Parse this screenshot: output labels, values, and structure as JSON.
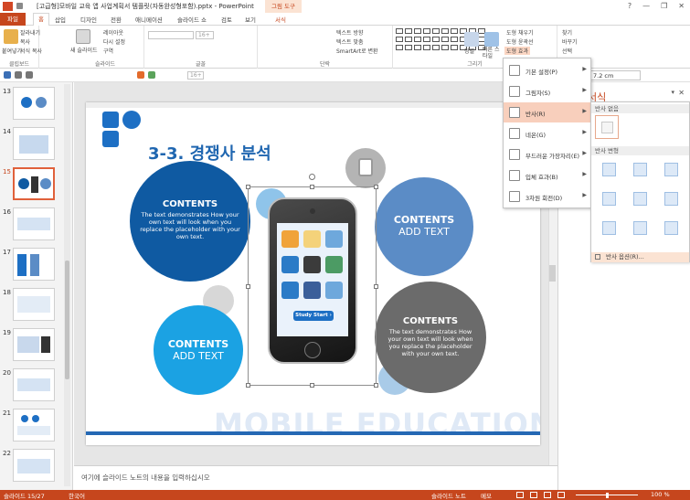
{
  "window": {
    "title": "[고급형]모바일 교육 앱 사업계획서 템플릿(자동완성형포함).pptx - PowerPoint",
    "context_tool": "그림 도구",
    "controls": [
      "?",
      "—",
      "❐",
      "✕"
    ]
  },
  "tabs": [
    "파일",
    "홈",
    "삽입",
    "디자인",
    "전환",
    "애니메이션",
    "슬라이드 쇼",
    "검토",
    "보기",
    "서식"
  ],
  "ribbon": {
    "clipboard": {
      "paste": "붙여넣기",
      "cut": "잘라내기",
      "copy": "복사",
      "format_painter": "서식 복사",
      "label": "클립보드"
    },
    "slides": {
      "new_slide": "새 슬라이드",
      "layout": "레이아웃",
      "reset": "다시 설정",
      "section": "구역",
      "label": "슬라이드"
    },
    "font": {
      "size": "16+",
      "label": "글꼴"
    },
    "paragraph": {
      "text_direction": "텍스트 방향",
      "align_text": "텍스트 맞춤",
      "smartart": "SmartArt로 변환",
      "label": "단락"
    },
    "drawing": {
      "arrange": "정렬",
      "quick_styles": "빠른 스타일",
      "fill": "도형 채우기",
      "outline": "도형 윤곽선",
      "effects": "도형 효과",
      "label": "그리기"
    },
    "editing": {
      "find": "찾기",
      "replace": "바꾸기",
      "select": "선택"
    }
  },
  "toolbar2": {
    "font_size": "16+"
  },
  "slides_panel": {
    "items": [
      {
        "num": "13",
        "selected": false
      },
      {
        "num": "14",
        "selected": false
      },
      {
        "num": "15",
        "selected": true
      },
      {
        "num": "16",
        "selected": false
      },
      {
        "num": "17",
        "selected": false
      },
      {
        "num": "18",
        "selected": false
      },
      {
        "num": "19",
        "selected": false
      },
      {
        "num": "20",
        "selected": false
      },
      {
        "num": "21",
        "selected": false
      },
      {
        "num": "22",
        "selected": false
      }
    ]
  },
  "slide": {
    "title": "3-3. 경쟁사 분석",
    "watermark": "MOBILE EDUCATION",
    "bubble1": {
      "head": "CONTENTS",
      "body": "The text demonstrates How your own text will look when you replace the placeholder with your own text."
    },
    "bubble2": {
      "head": "CONTENTS",
      "sub": "ADD TEXT"
    },
    "bubble3": {
      "head": "CONTENTS",
      "sub": "ADD TEXT"
    },
    "bubble4": {
      "head": "CONTENTS",
      "body": "The text demonstrates How your own text will look when you replace the placeholder with your own text."
    },
    "study_button": "Study Start ›",
    "colors": {
      "dark_blue": "#0f5aa2",
      "steel_blue": "#5b8cc6",
      "cyan": "#1ba2e3",
      "gray": "#6b6b6b",
      "title": "#1f66b0",
      "accent": "#c6461d"
    }
  },
  "notes": {
    "placeholder": "여기에 슬라이드 노트의 내용을 입력하십시오"
  },
  "status": {
    "slide": "슬라이드 15/27",
    "language": "한국어",
    "notes_btn": "슬라이드 노트",
    "comments_btn": "메모",
    "zoom": "100 %"
  },
  "format_pane": {
    "title": "서식",
    "size_value": "7.2 cm"
  },
  "effects_menu": {
    "items": [
      {
        "label": "기본 설정(P)",
        "highlighted": false
      },
      {
        "label": "그림자(S)",
        "highlighted": false
      },
      {
        "label": "반사(R)",
        "highlighted": true
      },
      {
        "label": "네온(G)",
        "highlighted": false
      },
      {
        "label": "부드러운 가장자리(E)",
        "highlighted": false
      },
      {
        "label": "입체 효과(B)",
        "highlighted": false
      },
      {
        "label": "3차원 회전(D)",
        "highlighted": false
      }
    ]
  },
  "reflection_submenu": {
    "none_header": "반사 없음",
    "variations_header": "반사 변형",
    "options": "반사 옵션(R)..."
  }
}
